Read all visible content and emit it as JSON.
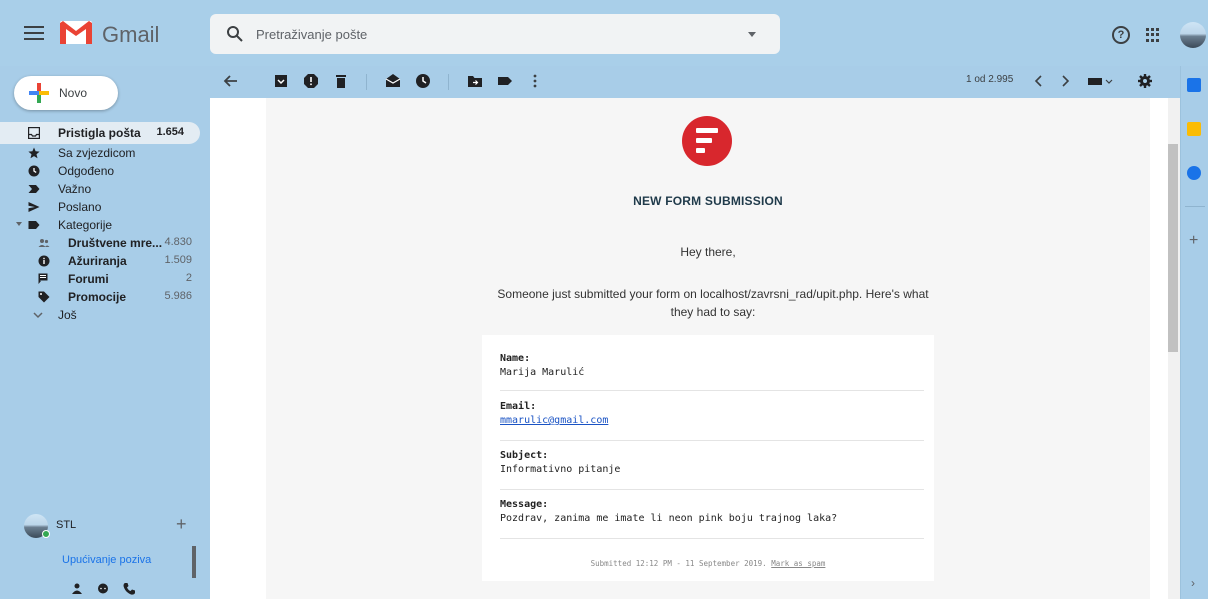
{
  "app": {
    "name": "Gmail"
  },
  "search": {
    "placeholder": "Pretraživanje pošte"
  },
  "compose": {
    "label": "Novo"
  },
  "sidebar": {
    "items": [
      {
        "label": "Pristigla pošta",
        "count": "1.654",
        "icon": "inbox-icon"
      },
      {
        "label": "Sa zvjezdicom",
        "count": "",
        "icon": "star-icon"
      },
      {
        "label": "Odgođeno",
        "count": "",
        "icon": "clock-icon"
      },
      {
        "label": "Važno",
        "count": "",
        "icon": "important-icon"
      },
      {
        "label": "Poslano",
        "count": "",
        "icon": "send-icon"
      },
      {
        "label": "Kategorije",
        "count": "",
        "icon": "label-icon"
      }
    ],
    "categories": [
      {
        "label": "Društvene mre...",
        "count": "4.830",
        "icon": "people-icon"
      },
      {
        "label": "Ažuriranja",
        "count": "1.509",
        "icon": "info-icon"
      },
      {
        "label": "Forumi",
        "count": "2",
        "icon": "forum-icon"
      },
      {
        "label": "Promocije",
        "count": "5.986",
        "icon": "tag-icon"
      }
    ],
    "more": "Još"
  },
  "hangouts": {
    "user": "STL",
    "invite_label": "Upućivanje poziva"
  },
  "toolbar": {
    "page_count": "1 od 2.995"
  },
  "email": {
    "title": "NEW FORM SUBMISSION",
    "greeting": "Hey there,",
    "intro": "Someone just submitted your form on localhost/zavrsni_rad/upit.php. Here's what they had to say:",
    "fields": [
      {
        "key": "Name:",
        "value": "Marija Marulić"
      },
      {
        "key": "Email:",
        "value": "mmarulic@gmail.com"
      },
      {
        "key": "Subject:",
        "value": "Informativno pitanje"
      },
      {
        "key": "Message:",
        "value": "Pozdrav, zanima me imate li neon pink boju trajnog laka?"
      }
    ],
    "footer": {
      "submitted": "Submitted 12:12 PM - 11 September 2019.",
      "spam_link": "Mark as spam"
    }
  },
  "colors": {
    "accent_red": "#d8272d",
    "header_bg": "#a9cfe9",
    "link": "#1a53c4"
  }
}
